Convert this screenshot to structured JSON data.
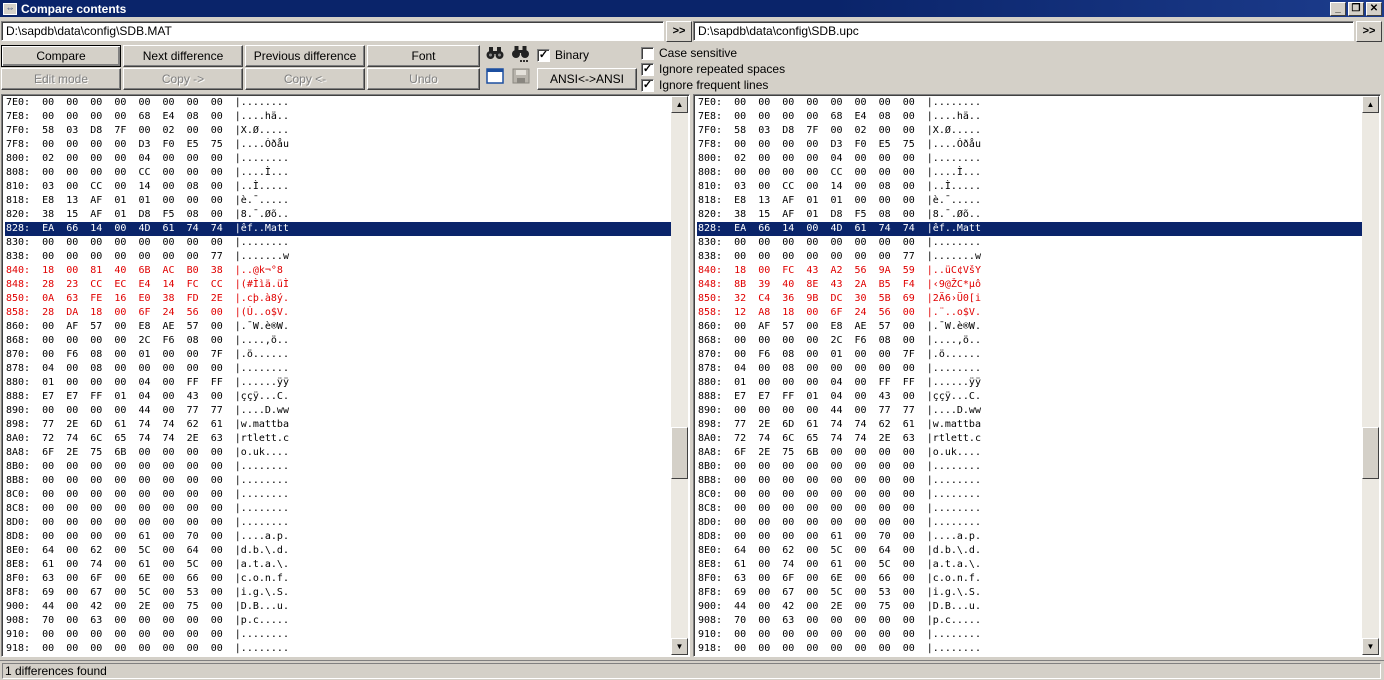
{
  "window": {
    "title": "Compare contents",
    "controls": [
      "_",
      "❐",
      "✕"
    ]
  },
  "left": {
    "path": "D:\\sapdb\\data\\config\\SDB.MAT",
    "lines": [
      {
        "t": "7E0:  00  00  00  00  00  00  00  00  |........"
      },
      {
        "t": "7E8:  00  00  00  00  68  E4  08  00  |....hä.."
      },
      {
        "t": "7F0:  58  03  D8  7F  00  02  00  00  |X.Ø....."
      },
      {
        "t": "7F8:  00  00  00  00  D3  F0  E5  75  |....Óðåu"
      },
      {
        "t": "800:  02  00  00  00  04  00  00  00  |........"
      },
      {
        "t": "808:  00  00  00  00  CC  00  00  00  |....Ì..."
      },
      {
        "t": "810:  03  00  CC  00  14  00  08  00  |..Ì....."
      },
      {
        "t": "818:  E8  13  AF  01  01  00  00  00  |è.¯....."
      },
      {
        "t": "820:  38  15  AF  01  D8  F5  08  00  |8.¯.Øõ.."
      },
      {
        "t": "828:  EA  66  14  00  4D  61  74  74  |êf..Matt",
        "s": 1
      },
      {
        "t": "830:  00  00  00  00  00  00  00  00  |........"
      },
      {
        "t": "838:  00  00  00  00  00  00  00  77  |.......w"
      },
      {
        "t": "840:  18  00  81  40  6B  AC  B0  38  |..@k¬°8",
        "d": 1
      },
      {
        "t": "848:  28  23  CC  EC  E4  14  FC  CC  |(#Ììä.üÌ",
        "d": 1
      },
      {
        "t": "850:  0A  63  FE  16  E0  38  FD  2E  |.cþ.à8ý.",
        "d": 1
      },
      {
        "t": "858:  28  DA  18  00  6F  24  56  00  |(Ú..o$V.",
        "d": 1
      },
      {
        "t": "860:  00  AF  57  00  E8  AE  57  00  |.¯W.è®W."
      },
      {
        "t": "868:  00  00  00  00  2C  F6  08  00  |....,ö.."
      },
      {
        "t": "870:  00  F6  08  00  01  00  00  7F  |.ö......"
      },
      {
        "t": "878:  04  00  08  00  00  00  00  00  |........"
      },
      {
        "t": "880:  01  00  00  00  04  00  FF  FF  |......ÿÿ"
      },
      {
        "t": "888:  E7  E7  FF  01  04  00  43  00  |ççÿ...C."
      },
      {
        "t": "890:  00  00  00  00  44  00  77  77  |....D.ww"
      },
      {
        "t": "898:  77  2E  6D  61  74  74  62  61  |w.mattba"
      },
      {
        "t": "8A0:  72  74  6C  65  74  74  2E  63  |rtlett.c"
      },
      {
        "t": "8A8:  6F  2E  75  6B  00  00  00  00  |o.uk...."
      },
      {
        "t": "8B0:  00  00  00  00  00  00  00  00  |........"
      },
      {
        "t": "8B8:  00  00  00  00  00  00  00  00  |........"
      },
      {
        "t": "8C0:  00  00  00  00  00  00  00  00  |........"
      },
      {
        "t": "8C8:  00  00  00  00  00  00  00  00  |........"
      },
      {
        "t": "8D0:  00  00  00  00  00  00  00  00  |........"
      },
      {
        "t": "8D8:  00  00  00  00  61  00  70  00  |....a.p."
      },
      {
        "t": "8E0:  64  00  62  00  5C  00  64  00  |d.b.\\.d."
      },
      {
        "t": "8E8:  61  00  74  00  61  00  5C  00  |a.t.a.\\."
      },
      {
        "t": "8F0:  63  00  6F  00  6E  00  66  00  |c.o.n.f."
      },
      {
        "t": "8F8:  69  00  67  00  5C  00  53  00  |i.g.\\.S."
      },
      {
        "t": "900:  44  00  42  00  2E  00  75  00  |D.B...u."
      },
      {
        "t": "908:  70  00  63  00  00  00  00  00  |p.c....."
      },
      {
        "t": "910:  00  00  00  00  00  00  00  00  |........"
      },
      {
        "t": "918:  00  00  00  00  00  00  00  00  |........"
      }
    ]
  },
  "right": {
    "path": "D:\\sapdb\\data\\config\\SDB.upc",
    "lines": [
      {
        "t": "7E0:  00  00  00  00  00  00  00  00  |........"
      },
      {
        "t": "7E8:  00  00  00  00  68  E4  08  00  |....hä.."
      },
      {
        "t": "7F0:  58  03  D8  7F  00  02  00  00  |X.Ø....."
      },
      {
        "t": "7F8:  00  00  00  00  D3  F0  E5  75  |....Óðåu"
      },
      {
        "t": "800:  02  00  00  00  04  00  00  00  |........"
      },
      {
        "t": "808:  00  00  00  00  CC  00  00  00  |....Ì..."
      },
      {
        "t": "810:  03  00  CC  00  14  00  08  00  |..Ì....."
      },
      {
        "t": "818:  E8  13  AF  01  01  00  00  00  |è.¯....."
      },
      {
        "t": "820:  38  15  AF  01  D8  F5  08  00  |8.¯.Øõ.."
      },
      {
        "t": "828:  EA  66  14  00  4D  61  74  74  |êf..Matt",
        "s": 1
      },
      {
        "t": "830:  00  00  00  00  00  00  00  00  |........"
      },
      {
        "t": "838:  00  00  00  00  00  00  00  77  |.......w"
      },
      {
        "t": "840:  18  00  FC  43  A2  56  9A  59  |..üC¢VšY",
        "d": 1
      },
      {
        "t": "848:  8B  39  40  8E  43  2A  B5  F4  |‹9@ŽC*µô",
        "d": 1
      },
      {
        "t": "850:  32  C4  36  9B  DC  30  5B  69  |2Ä6›Ü0[i",
        "d": 1
      },
      {
        "t": "858:  12  A8  18  00  6F  24  56  00  |.¨..o$V.",
        "d": 1
      },
      {
        "t": "860:  00  AF  57  00  E8  AE  57  00  |.¯W.è®W."
      },
      {
        "t": "868:  00  00  00  00  2C  F6  08  00  |....,ö.."
      },
      {
        "t": "870:  00  F6  08  00  01  00  00  7F  |.ö......"
      },
      {
        "t": "878:  04  00  08  00  00  00  00  00  |........"
      },
      {
        "t": "880:  01  00  00  00  04  00  FF  FF  |......ÿÿ"
      },
      {
        "t": "888:  E7  E7  FF  01  04  00  43  00  |ççÿ...C."
      },
      {
        "t": "890:  00  00  00  00  44  00  77  77  |....D.ww"
      },
      {
        "t": "898:  77  2E  6D  61  74  74  62  61  |w.mattba"
      },
      {
        "t": "8A0:  72  74  6C  65  74  74  2E  63  |rtlett.c"
      },
      {
        "t": "8A8:  6F  2E  75  6B  00  00  00  00  |o.uk...."
      },
      {
        "t": "8B0:  00  00  00  00  00  00  00  00  |........"
      },
      {
        "t": "8B8:  00  00  00  00  00  00  00  00  |........"
      },
      {
        "t": "8C0:  00  00  00  00  00  00  00  00  |........"
      },
      {
        "t": "8C8:  00  00  00  00  00  00  00  00  |........"
      },
      {
        "t": "8D0:  00  00  00  00  00  00  00  00  |........"
      },
      {
        "t": "8D8:  00  00  00  00  61  00  70  00  |....a.p."
      },
      {
        "t": "8E0:  64  00  62  00  5C  00  64  00  |d.b.\\.d."
      },
      {
        "t": "8E8:  61  00  74  00  61  00  5C  00  |a.t.a.\\."
      },
      {
        "t": "8F0:  63  00  6F  00  6E  00  66  00  |c.o.n.f."
      },
      {
        "t": "8F8:  69  00  67  00  5C  00  53  00  |i.g.\\.S."
      },
      {
        "t": "900:  44  00  42  00  2E  00  75  00  |D.B...u."
      },
      {
        "t": "908:  70  00  63  00  00  00  00  00  |p.c....."
      },
      {
        "t": "910:  00  00  00  00  00  00  00  00  |........"
      },
      {
        "t": "918:  00  00  00  00  00  00  00  00  |........"
      }
    ]
  },
  "browse_label": ">>",
  "toolbar": {
    "compare": "Compare",
    "next_difference": "Next difference",
    "previous_difference": "Previous difference",
    "font": "Font",
    "edit_mode": "Edit mode",
    "copy_right": "Copy ->",
    "copy_left": "Copy <-",
    "undo": "Undo",
    "ansi": "ANSI<->ANSI",
    "binary": "Binary"
  },
  "options": {
    "case_sensitive": {
      "label": "Case sensitive",
      "checked": false
    },
    "ignore_repeated_spaces": {
      "label": "Ignore repeated spaces",
      "checked": true
    },
    "ignore_frequent_lines": {
      "label": "Ignore frequent lines",
      "checked": true
    },
    "binary_checked": true
  },
  "scroll": {
    "left_position": 0.66,
    "right_position": 0.66
  },
  "status": "1 differences found"
}
